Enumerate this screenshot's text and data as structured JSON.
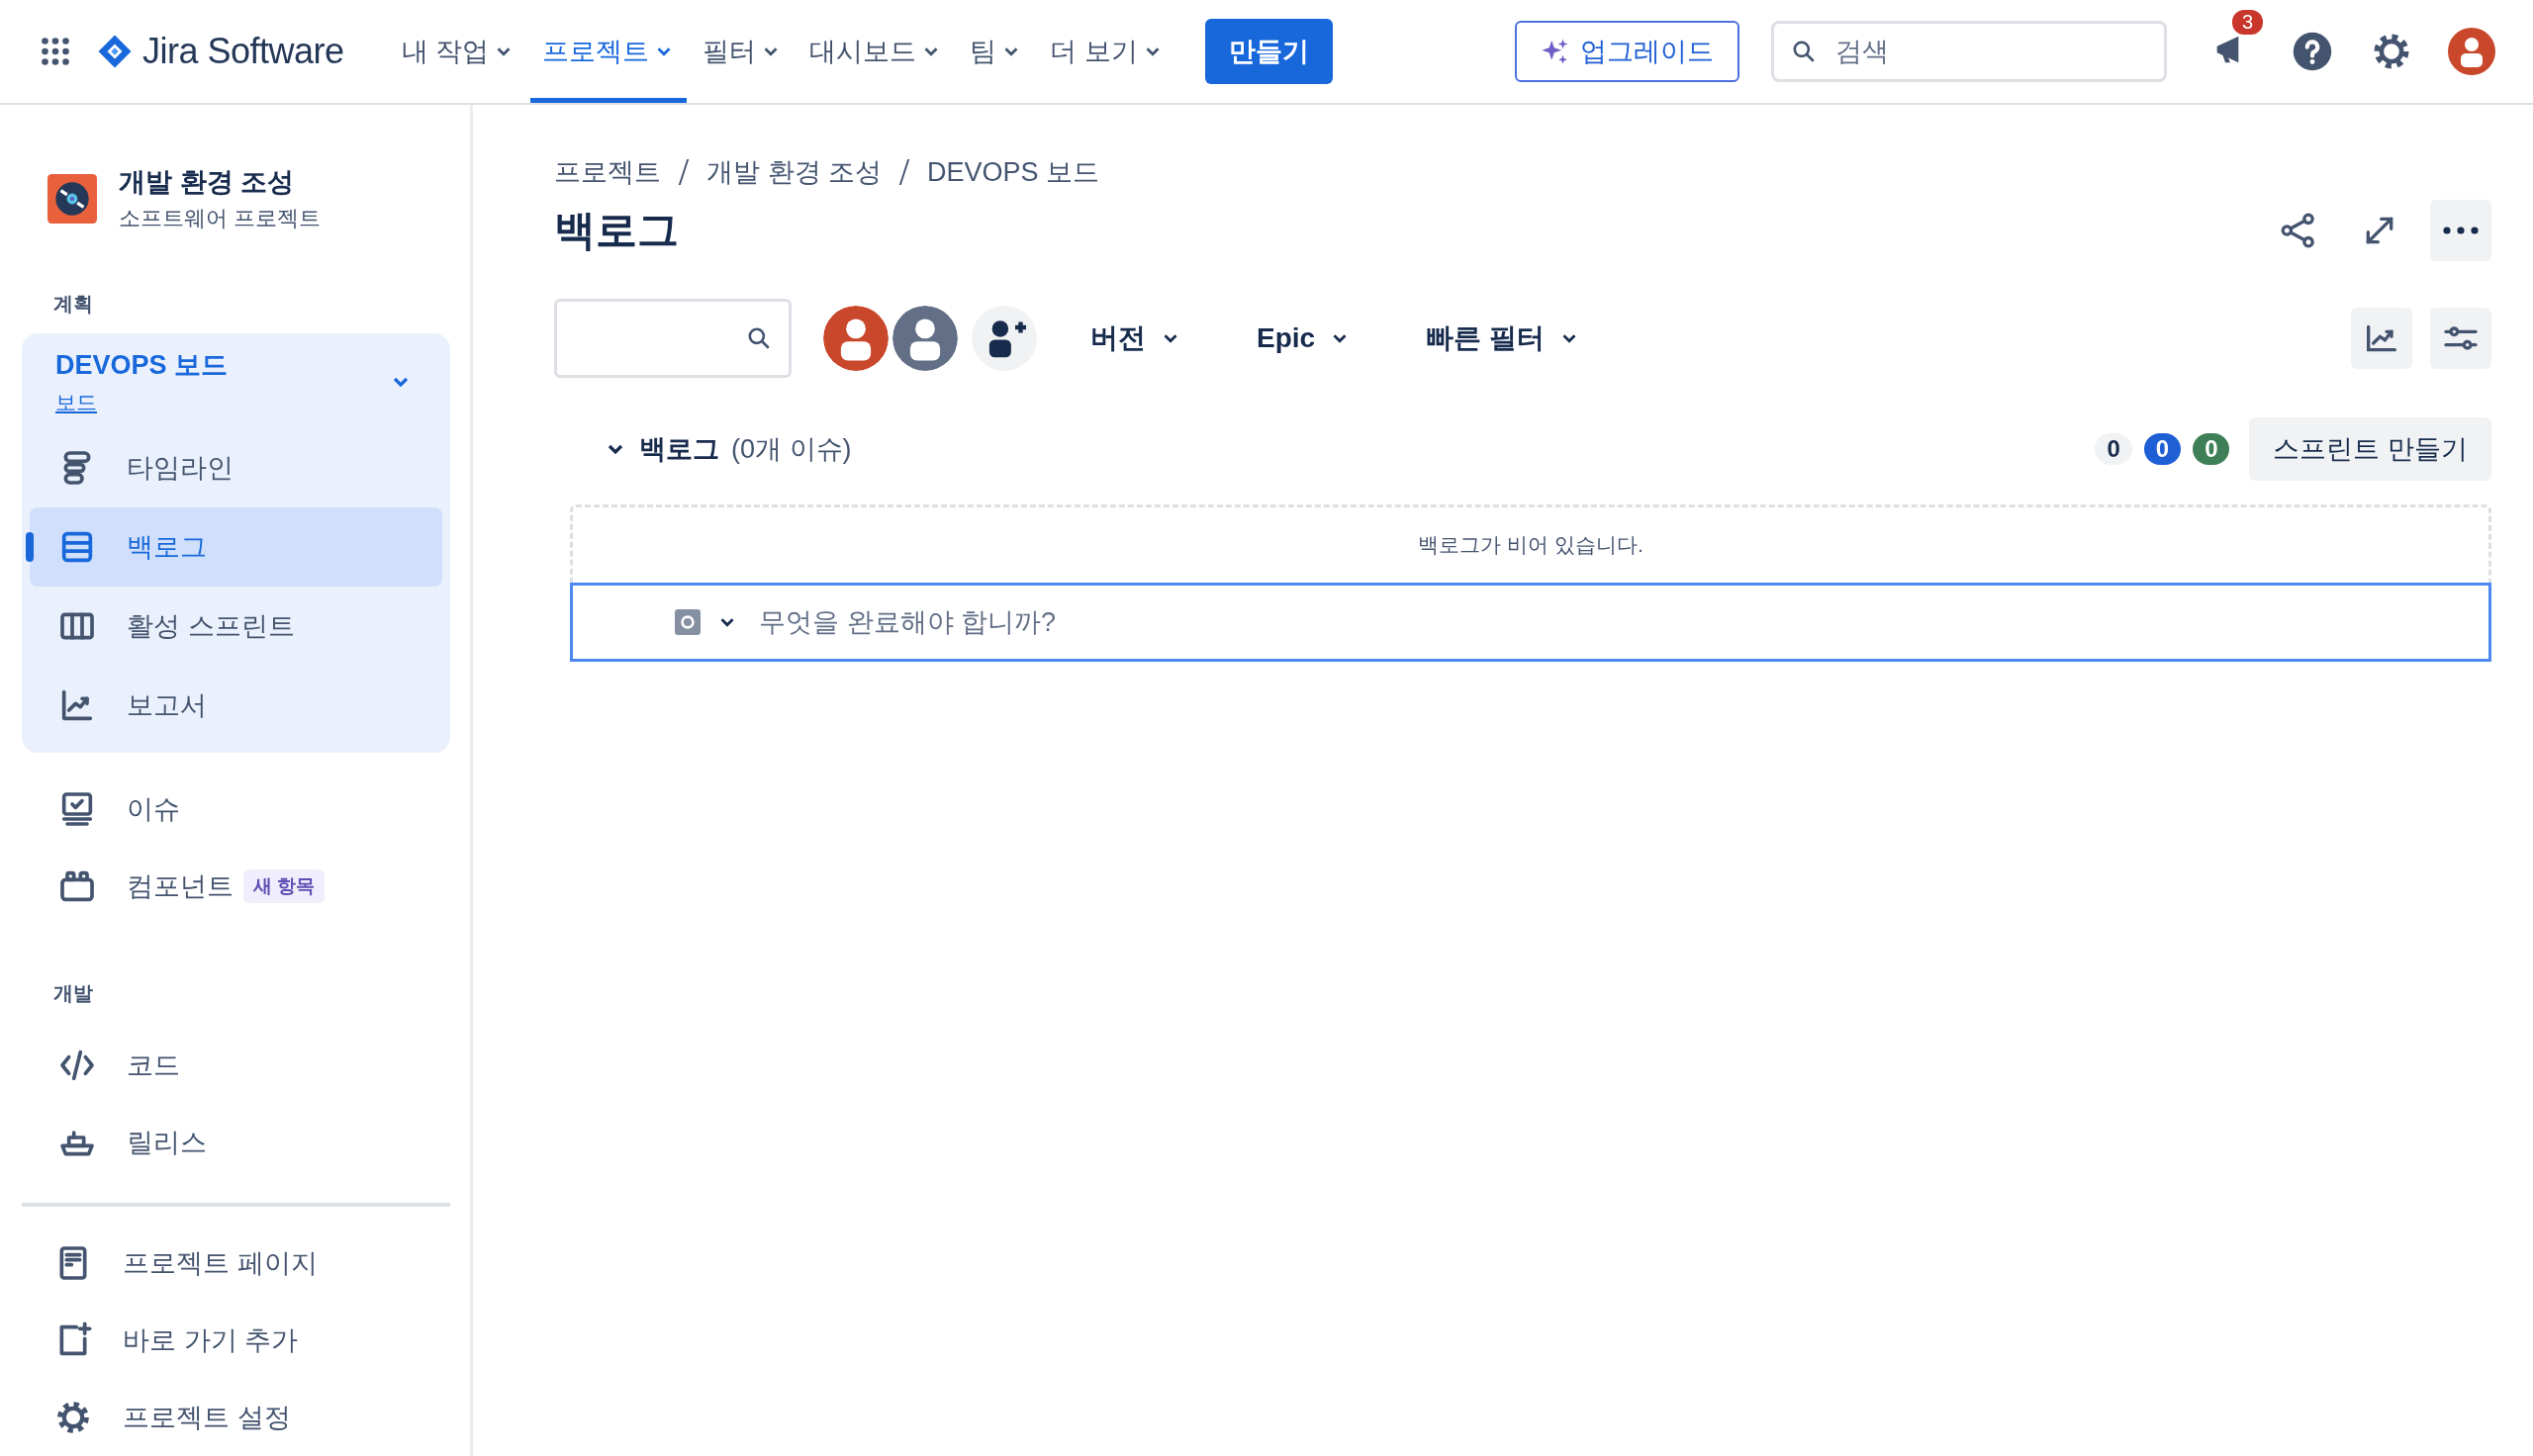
{
  "topnav": {
    "product": "Jira Software",
    "menus": [
      {
        "label": "내 작업",
        "selected": false
      },
      {
        "label": "프로젝트",
        "selected": true
      },
      {
        "label": "필터",
        "selected": false
      },
      {
        "label": "대시보드",
        "selected": false
      },
      {
        "label": "팀",
        "selected": false
      },
      {
        "label": "더 보기",
        "selected": false
      }
    ],
    "create": "만들기",
    "upgrade": "업그레이드",
    "search": {
      "placeholder": "검색"
    },
    "notifications": "3"
  },
  "sidebar": {
    "project": {
      "name": "개발 환경 조성",
      "type": "소프트웨어 프로젝트"
    },
    "planning": {
      "heading": "계획",
      "board": {
        "title": "DEVOPS 보드",
        "subtitle": "보드",
        "expanded": true,
        "items": [
          {
            "label": "타임라인",
            "selected": false
          },
          {
            "label": "백로그",
            "selected": true
          },
          {
            "label": "활성 스프린트",
            "selected": false
          },
          {
            "label": "보고서",
            "selected": false
          }
        ]
      },
      "items": [
        {
          "label": "이슈",
          "selected": false
        },
        {
          "label": "컴포넌트",
          "badge": "새 항목",
          "selected": false
        }
      ]
    },
    "development": {
      "heading": "개발",
      "items": [
        {
          "label": "코드",
          "selected": false
        },
        {
          "label": "릴리스",
          "selected": false
        }
      ]
    },
    "footer": [
      {
        "label": "프로젝트 페이지",
        "selected": false
      },
      {
        "label": "바로 가기 추가",
        "selected": false
      },
      {
        "label": "프로젝트 설정",
        "selected": false
      }
    ]
  },
  "main": {
    "breadcrumbs": [
      "프로젝트",
      "개발 환경 조성",
      "DEVOPS 보드"
    ],
    "title": "백로그",
    "avatars": [
      {
        "color": "#c9472a"
      },
      {
        "color": "#626f86"
      }
    ],
    "filters": [
      "버전",
      "Epic",
      "빠른 필터"
    ],
    "backlog": {
      "title": "백로그",
      "count": "(0개 이슈)",
      "expanded": true,
      "counts": [
        {
          "value": "0",
          "color": "#f1f2f4"
        },
        {
          "value": "0",
          "color": "#1f5fd6"
        },
        {
          "value": "0",
          "color": "#3f7f57"
        }
      ],
      "create_sprint": "스프린트 만들기",
      "empty": "백로그가 비어 있습니다.",
      "new_issue": {
        "placeholder": "무엇을 완료해야 합니까?"
      }
    }
  }
}
